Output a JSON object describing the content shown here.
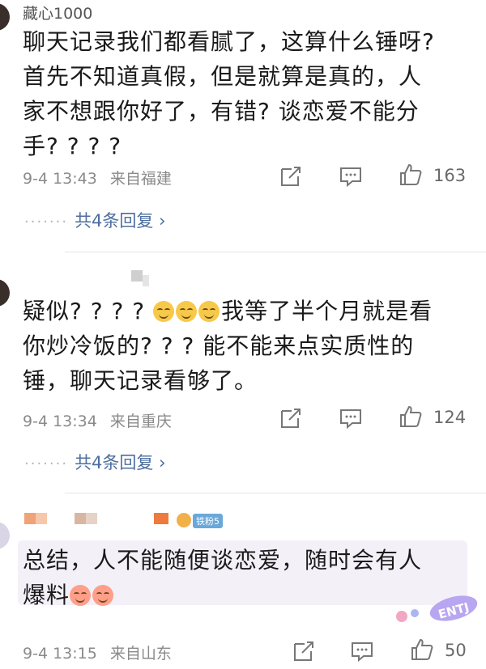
{
  "comments": [
    {
      "username": "藏心1000",
      "lines": [
        "聊天记录我们都看腻了，这算什么锤呀?",
        "首先不知道真假，但是就算是真的，人",
        "家不想跟你好了，有错? 谈恋爱不能分",
        "手? ? ? ?"
      ],
      "date": "9-4 13:43",
      "location": "来自福建",
      "likes": "163",
      "replies": "共4条回复 ›"
    },
    {
      "username": "",
      "lines_first_prefix": "疑似? ? ? ? ",
      "lines_first_suffix": "我等了半个月就是看",
      "lines": [
        "你炒冷饭的? ? ? 能不能来点实质性的",
        "锤，聊天记录看够了。"
      ],
      "date": "9-4 13:34",
      "location": "来自重庆",
      "likes": "124",
      "replies": "共4条回复 ›"
    },
    {
      "username": "",
      "badge": "铁粉5",
      "lines": [
        "总结，人不能随便谈恋爱，随时会有人",
        "爆料"
      ],
      "date": "9-4 13:15",
      "location": "来自山东",
      "likes": "50"
    }
  ],
  "watermark": "ENTJ",
  "icons": [
    "share-icon",
    "comment-icon",
    "like-icon"
  ],
  "colors": {
    "reply_link": "#4d6e9e",
    "meta_gray": "#8a8a8a"
  }
}
